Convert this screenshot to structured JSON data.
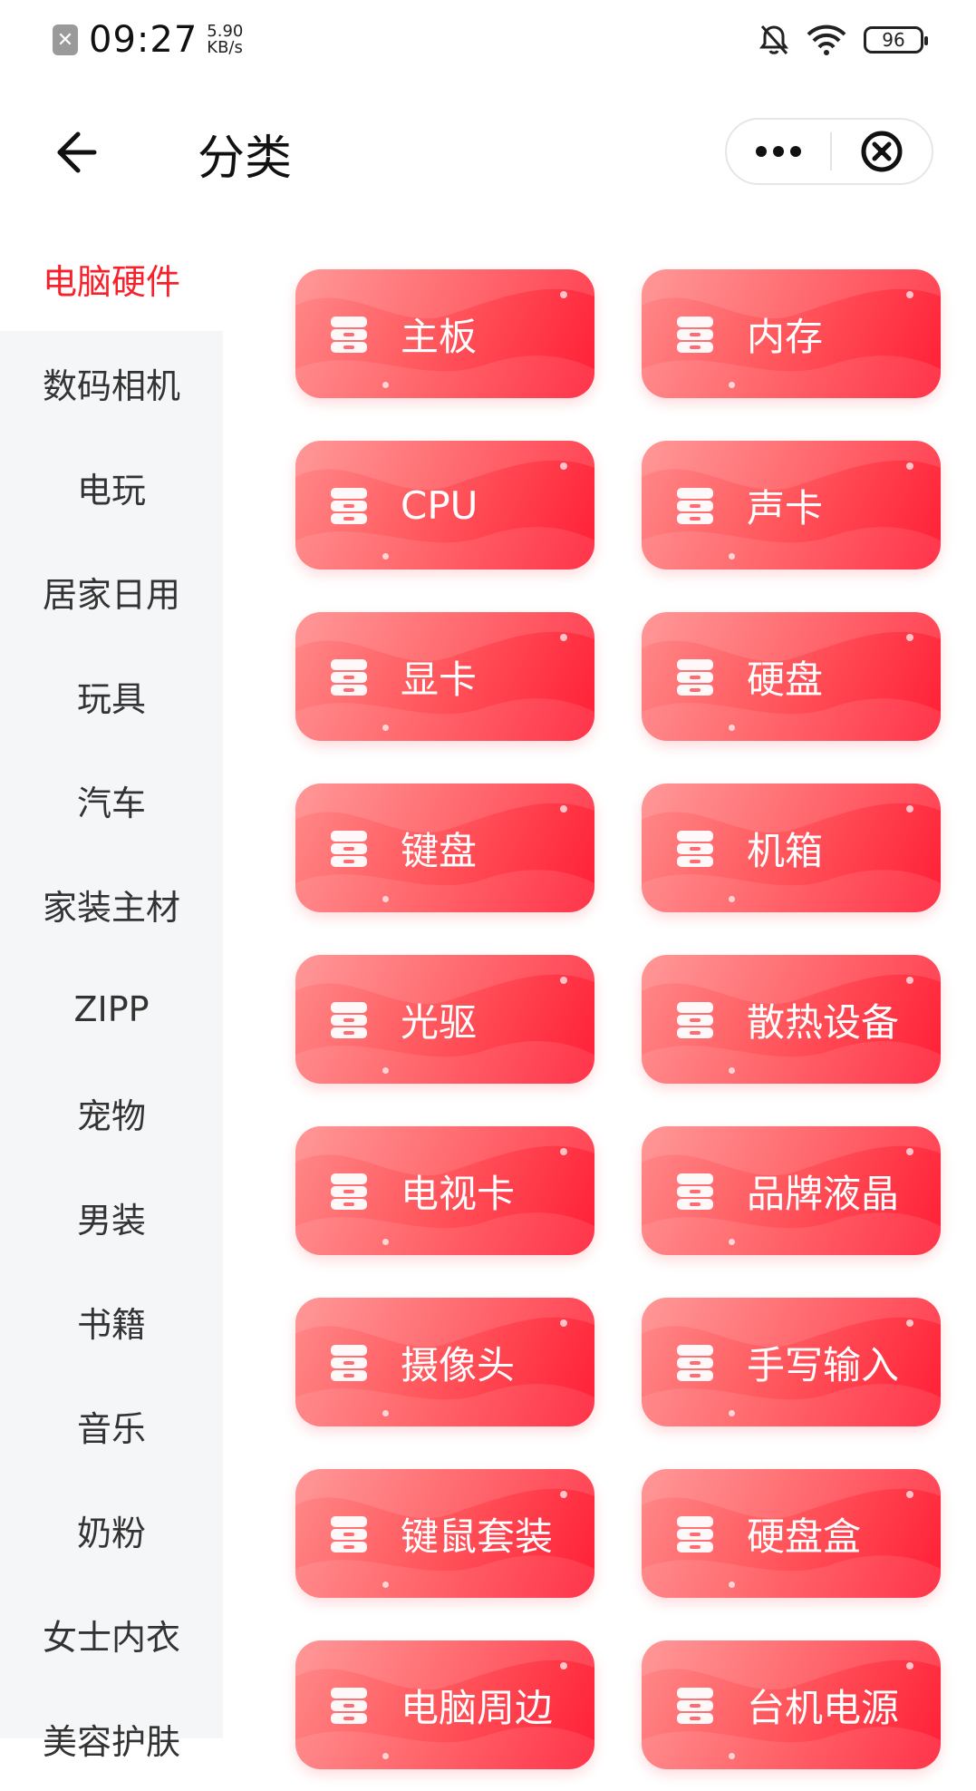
{
  "status_bar": {
    "time": "09:27",
    "speed_value": "5.90",
    "speed_unit": "KB/s",
    "battery": "96"
  },
  "nav": {
    "title": "分类"
  },
  "sidebar": {
    "items": [
      {
        "label": "电脑硬件",
        "active": true
      },
      {
        "label": "数码相机"
      },
      {
        "label": "电玩"
      },
      {
        "label": "居家日用"
      },
      {
        "label": "玩具"
      },
      {
        "label": "汽车"
      },
      {
        "label": "家装主材"
      },
      {
        "label": "ZIPP"
      },
      {
        "label": "宠物"
      },
      {
        "label": "男装"
      },
      {
        "label": "书籍"
      },
      {
        "label": "音乐"
      },
      {
        "label": "奶粉"
      },
      {
        "label": "女士内衣"
      },
      {
        "label": "美容护肤"
      }
    ]
  },
  "subcategories": [
    {
      "label": "主板"
    },
    {
      "label": "内存"
    },
    {
      "label": "CPU"
    },
    {
      "label": "声卡"
    },
    {
      "label": "显卡"
    },
    {
      "label": "硬盘"
    },
    {
      "label": "键盘"
    },
    {
      "label": "机箱"
    },
    {
      "label": "光驱"
    },
    {
      "label": "散热设备"
    },
    {
      "label": "电视卡"
    },
    {
      "label": "品牌液晶"
    },
    {
      "label": "摄像头"
    },
    {
      "label": "手写输入"
    },
    {
      "label": "键鼠套装"
    },
    {
      "label": "硬盘盒"
    },
    {
      "label": "电脑周边"
    },
    {
      "label": "台机电源"
    }
  ],
  "colors": {
    "accent": "#f5222d",
    "tile_start": "#ff8a8a",
    "tile_end": "#ff1e36",
    "sidebar_bg": "#f5f6f8"
  }
}
